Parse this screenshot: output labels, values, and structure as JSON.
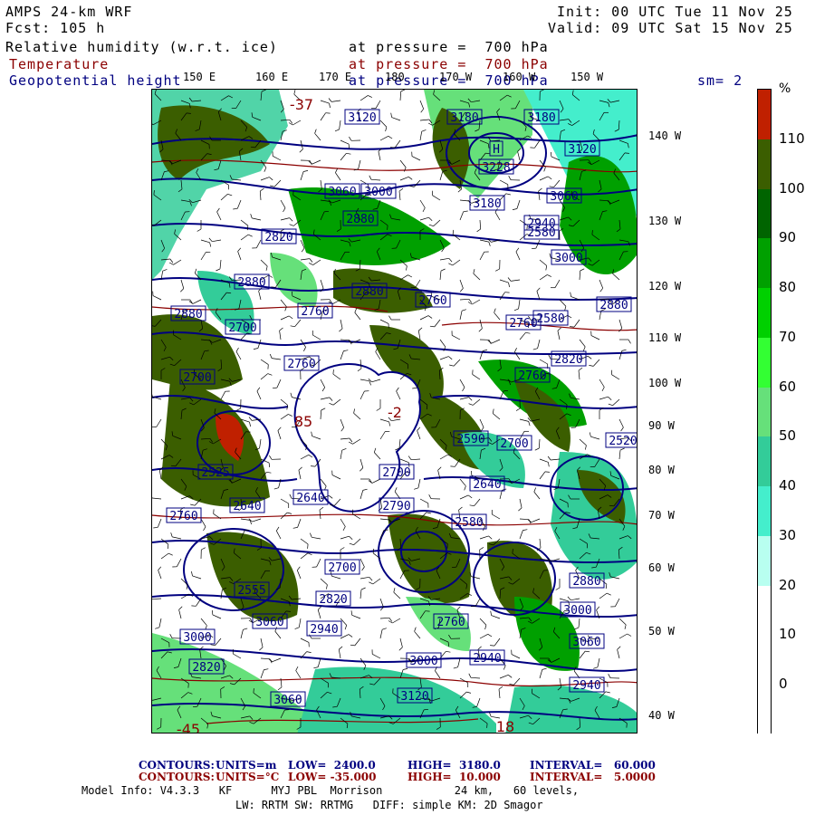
{
  "header": {
    "model": "AMPS 24-km WRF",
    "forecast": "Fcst: 105 h",
    "init": "Init: 00 UTC Tue 11 Nov 25",
    "valid": "Valid: 09 UTC Sat 15 Nov 25",
    "fields": [
      {
        "name": "Relative humidity (w.r.t. ice)",
        "level": "at pressure =  700 hPa",
        "color": "#000000"
      },
      {
        "name": "Temperature",
        "level": "at pressure =  700 hPa",
        "color": "#8b0000"
      },
      {
        "name": "Geopotential height",
        "level": "at pressure =  700 hPa",
        "color": "#000080"
      }
    ],
    "smoothing": "sm= 2"
  },
  "map": {
    "top_longitudes": [
      "150 E",
      "160 E",
      "170 E",
      "180",
      "170 W",
      "160 W",
      "150 W"
    ],
    "right_latitudes": [
      "140 W",
      "130 W",
      "120 W",
      "110 W",
      "100 W",
      "90 W",
      "80 W",
      "70 W",
      "60 W",
      "50 W",
      "40 W"
    ],
    "height_labels": [
      {
        "text": "3120"
      },
      {
        "text": "3180"
      },
      {
        "text": "3180"
      },
      {
        "text": "3228"
      },
      {
        "text": "H"
      },
      {
        "text": "3120"
      },
      {
        "text": "3060"
      },
      {
        "text": "3060"
      },
      {
        "text": "3000"
      },
      {
        "text": "2880"
      },
      {
        "text": "2820"
      },
      {
        "text": "2940"
      },
      {
        "text": "3180"
      },
      {
        "text": "3000"
      },
      {
        "text": "2880"
      },
      {
        "text": "2760"
      },
      {
        "text": "2880"
      },
      {
        "text": "2760"
      },
      {
        "text": "2880"
      },
      {
        "text": "2700"
      },
      {
        "text": "2580"
      },
      {
        "text": "2760"
      },
      {
        "text": "2760"
      },
      {
        "text": "2640"
      },
      {
        "text": "2820"
      },
      {
        "text": "2700"
      },
      {
        "text": "2590"
      },
      {
        "text": "2700"
      },
      {
        "text": "2525"
      },
      {
        "text": "2640"
      },
      {
        "text": "2760"
      },
      {
        "text": "2700"
      },
      {
        "text": "2790"
      },
      {
        "text": "2580"
      },
      {
        "text": "2555"
      },
      {
        "text": "2700"
      },
      {
        "text": "2820"
      },
      {
        "text": "2880"
      },
      {
        "text": "3000"
      },
      {
        "text": "2940"
      },
      {
        "text": "3060"
      },
      {
        "text": "2940"
      },
      {
        "text": "3000"
      },
      {
        "text": "3060"
      },
      {
        "text": "3120"
      },
      {
        "text": "3000"
      },
      {
        "text": "2760"
      },
      {
        "text": "2820"
      },
      {
        "text": "3060"
      },
      {
        "text": "2940"
      },
      {
        "text": "2880"
      },
      {
        "text": "2580"
      },
      {
        "text": "2520"
      },
      {
        "text": "2640"
      },
      {
        "text": "2760"
      }
    ],
    "temp_labels": [
      {
        "text": "85"
      },
      {
        "text": "-2"
      },
      {
        "text": "-45"
      },
      {
        "text": "18"
      },
      {
        "text": "-37"
      }
    ]
  },
  "colorbar": {
    "unit": "%",
    "labels": [
      "110",
      "100",
      "90",
      "80",
      "70",
      "60",
      "50",
      "40",
      "30",
      "20",
      "10",
      "0"
    ],
    "colors": [
      "#c02000",
      "#3b5e00",
      "#006400",
      "#00a000",
      "#00d000",
      "#33ff33",
      "#66e07a",
      "#33cc99",
      "#44eecc",
      "#b8fff0",
      "#ffffff",
      "#ffffff",
      "#ffffff"
    ]
  },
  "footer": {
    "height_contours": {
      "label": "CONTOURS:",
      "units": "UNITS=m",
      "low": "LOW=  2400.0",
      "high": "HIGH=  3180.0",
      "interval": "INTERVAL=   60.000",
      "color": "#000080"
    },
    "temp_contours": {
      "label": "CONTOURS:",
      "units": "UNITS=°C",
      "low": "LOW= -35.000",
      "high": "HIGH=  10.000",
      "interval": "INTERVAL=   5.0000",
      "color": "#8b0000"
    },
    "model_info_1": "Model Info: V4.3.3   KF      MYJ PBL  Morrison           24 km,   60 levels,",
    "model_info_2": "LW: RRTM SW: RRTMG   DIFF: simple KM: 2D Smagor"
  }
}
